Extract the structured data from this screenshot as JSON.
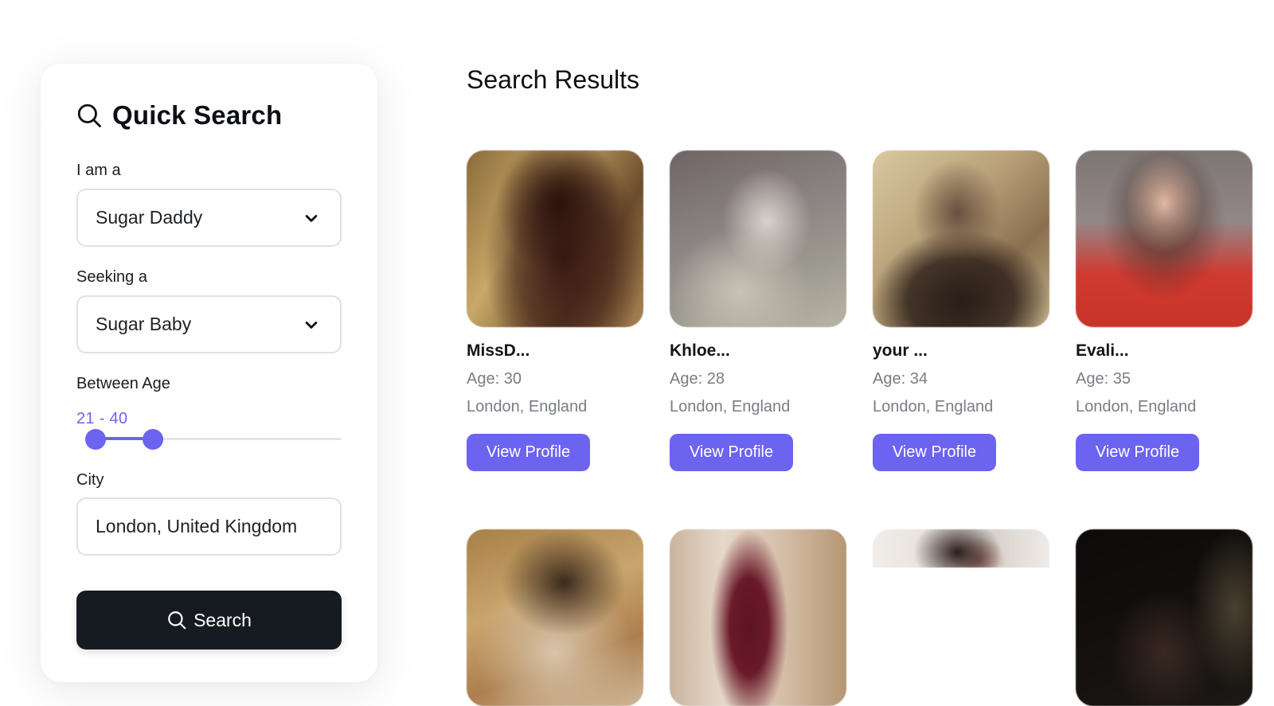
{
  "search_panel": {
    "title": "Quick Search",
    "i_am_label": "I am a",
    "i_am_value": "Sugar Daddy",
    "seeking_label": "Seeking a",
    "seeking_value": "Sugar Baby",
    "age_label": "Between Age",
    "age_range_text": "21 - 40",
    "age_min": 21,
    "age_max": 40,
    "city_label": "City",
    "city_value": "London, United Kingdom",
    "search_button": "Search"
  },
  "results": {
    "title": "Search Results",
    "view_button": "View Profile",
    "profiles": [
      {
        "name": "MissD...",
        "age": "Age: 30",
        "location": "London, England"
      },
      {
        "name": "Khloe...",
        "age": "Age: 28",
        "location": "London, England"
      },
      {
        "name": "your ...",
        "age": "Age: 34",
        "location": "London, England"
      },
      {
        "name": "Evali...",
        "age": "Age: 35",
        "location": "London, England"
      }
    ]
  },
  "colors": {
    "accent": "#6c63f0",
    "search_button_bg": "#161b21",
    "muted_text": "#7a7d84"
  }
}
